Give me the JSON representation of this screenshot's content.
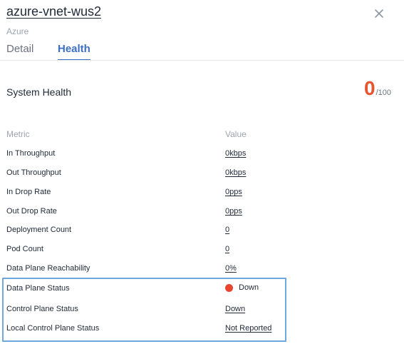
{
  "header": {
    "title": "azure-vnet-wus2",
    "subtitle": "Azure",
    "close_icon": "close-icon"
  },
  "tabs": [
    {
      "label": "Detail",
      "active": false
    },
    {
      "label": "Health",
      "active": true
    }
  ],
  "health": {
    "section_title": "System Health",
    "score": "0",
    "score_max": "/100",
    "score_color": "#e8542e"
  },
  "table": {
    "headers": {
      "metric": "Metric",
      "value": "Value"
    },
    "rows": [
      {
        "metric": "In Throughput",
        "value": "0kbps"
      },
      {
        "metric": "Out Throughput",
        "value": "0kbps"
      },
      {
        "metric": "In Drop Rate",
        "value": "0pps"
      },
      {
        "metric": "Out Drop Rate",
        "value": "0pps"
      },
      {
        "metric": "Deployment Count",
        "value": "0"
      },
      {
        "metric": "Pod Count",
        "value": "0"
      },
      {
        "metric": "Data Plane Reachability",
        "value": "0%"
      },
      {
        "metric": "Data Plane Status",
        "value": "Down",
        "status_color": "#e8452e"
      },
      {
        "metric": "Control Plane Status",
        "value": "Down"
      },
      {
        "metric": "Local Control Plane Status",
        "value": "Not Reported"
      }
    ]
  },
  "colors": {
    "accent": "#3b6fc4",
    "highlight_border": "#6fa8dc"
  }
}
